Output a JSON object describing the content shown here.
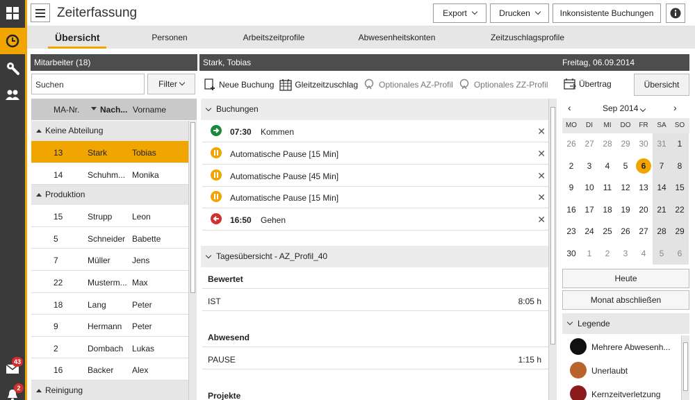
{
  "header": {
    "title": "Zeiterfassung",
    "export_label": "Export",
    "print_label": "Drucken",
    "inconsistent_label": "Inkonsistente Buchungen"
  },
  "tabs": [
    "Übersicht",
    "Personen",
    "Arbeitszeitprofile",
    "Abwesenheitskonten",
    "Zeitzuschlagsprofile"
  ],
  "rail": {
    "mail_count": "43",
    "notify_count": "2"
  },
  "employees_panel": {
    "title": "Mitarbeiter (18)",
    "search_placeholder": "Suchen",
    "filter_label": "Filter",
    "columns": [
      "MA-Nr.",
      "Nach...",
      "Vorname"
    ],
    "groups": [
      {
        "name": "Keine Abteilung",
        "rows": [
          {
            "nr": "13",
            "name": "Stark",
            "first": "Tobias",
            "selected": true
          },
          {
            "nr": "14",
            "name": "Schuhm...",
            "first": "Monika"
          }
        ]
      },
      {
        "name": "Produktion",
        "rows": [
          {
            "nr": "15",
            "name": "Strupp",
            "first": "Leon"
          },
          {
            "nr": "5",
            "name": "Schneider",
            "first": "Babette"
          },
          {
            "nr": "7",
            "name": "Müller",
            "first": "Jens"
          },
          {
            "nr": "22",
            "name": "Musterm...",
            "first": "Max"
          },
          {
            "nr": "18",
            "name": "Lang",
            "first": "Peter"
          },
          {
            "nr": "9",
            "name": "Hermann",
            "first": "Peter"
          },
          {
            "nr": "2",
            "name": "Dombach",
            "first": "Lukas"
          },
          {
            "nr": "16",
            "name": "Backer",
            "first": "Alex"
          }
        ]
      },
      {
        "name": "Reinigung",
        "rows": []
      }
    ]
  },
  "detail": {
    "person": "Stark, Tobias",
    "date": "Freitag, 06.09.2014",
    "toolbar": {
      "new_booking": "Neue Buchung",
      "flex_bonus": "Gleitzeitzuschlag",
      "opt_az": "Optionales AZ-Profil",
      "opt_zz": "Optionales ZZ-Profil",
      "transfer": "Übertrag",
      "overview": "Übersicht"
    },
    "bookings_title": "Buchungen",
    "bookings": [
      {
        "time": "07:30",
        "label": "Kommen",
        "kind": "in"
      },
      {
        "time": "",
        "label": "Automatische Pause  [15 Min]",
        "kind": "pause"
      },
      {
        "time": "",
        "label": "Automatische Pause  [45 Min]",
        "kind": "pause"
      },
      {
        "time": "",
        "label": "Automatische Pause  [15 Min]",
        "kind": "pause"
      },
      {
        "time": "16:50",
        "label": "Gehen",
        "kind": "out"
      }
    ],
    "day_title": "Tagesübersicht - AZ_Profil_40",
    "sections": {
      "rated": "Bewertet",
      "ist_label": "IST",
      "ist_value": "8:05 h",
      "absent": "Abwesend",
      "pause_label": "PAUSE",
      "pause_value": "1:15 h",
      "projects": "Projekte"
    }
  },
  "calendar": {
    "month": "Sep 2014",
    "weekdays": [
      "MO",
      "DI",
      "MI",
      "DO",
      "FR",
      "SA",
      "SO"
    ],
    "weeks": [
      [
        "26",
        "27",
        "28",
        "29",
        "30",
        "31",
        "1"
      ],
      [
        "2",
        "3",
        "4",
        "5",
        "6",
        "7",
        "8"
      ],
      [
        "9",
        "10",
        "11",
        "12",
        "13",
        "14",
        "15"
      ],
      [
        "16",
        "17",
        "18",
        "19",
        "20",
        "21",
        "22"
      ],
      [
        "23",
        "24",
        "25",
        "26",
        "27",
        "28",
        "29"
      ],
      [
        "30",
        "1",
        "2",
        "3",
        "4",
        "5",
        "6"
      ]
    ],
    "today_label": "Heute",
    "close_month_label": "Monat abschließen",
    "legend_title": "Legende",
    "legend": [
      {
        "label": "Mehrere Abwesenh...",
        "color": "#111111"
      },
      {
        "label": "Unerlaubt",
        "color": "#b8642a"
      },
      {
        "label": "Kernzeitverletzung",
        "color": "#8b1a1a"
      }
    ]
  },
  "colors": {
    "accent": "#f0a500",
    "dark": "#4d4d4d",
    "in": "#1a8a3a",
    "out": "#d32f2f"
  }
}
